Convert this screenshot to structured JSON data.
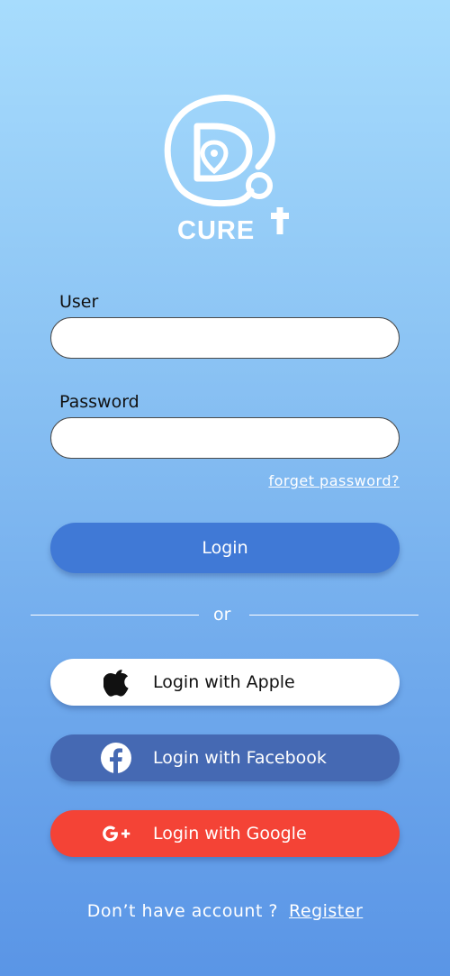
{
  "logo": {
    "text": "CURE",
    "icon": "stethoscope-location-icon"
  },
  "form": {
    "user_label": "User",
    "user_value": "",
    "user_placeholder": "",
    "password_label": "Password",
    "password_value": "",
    "password_placeholder": "",
    "forgot_label": "forget password?"
  },
  "buttons": {
    "login_label": "Login",
    "divider_text": "or",
    "apple_label": "Login with Apple",
    "apple_icon": "apple-icon",
    "facebook_label": "Login with Facebook",
    "facebook_icon": "facebook-icon",
    "google_label": "Login with Google",
    "google_icon": "google-plus-icon"
  },
  "footer": {
    "prompt": "Don’t have account ?",
    "register_label": "Register"
  },
  "colors": {
    "login_button": "#4079d6",
    "facebook_button": "#4569b3",
    "google_button": "#f44336",
    "apple_button": "#ffffff"
  }
}
